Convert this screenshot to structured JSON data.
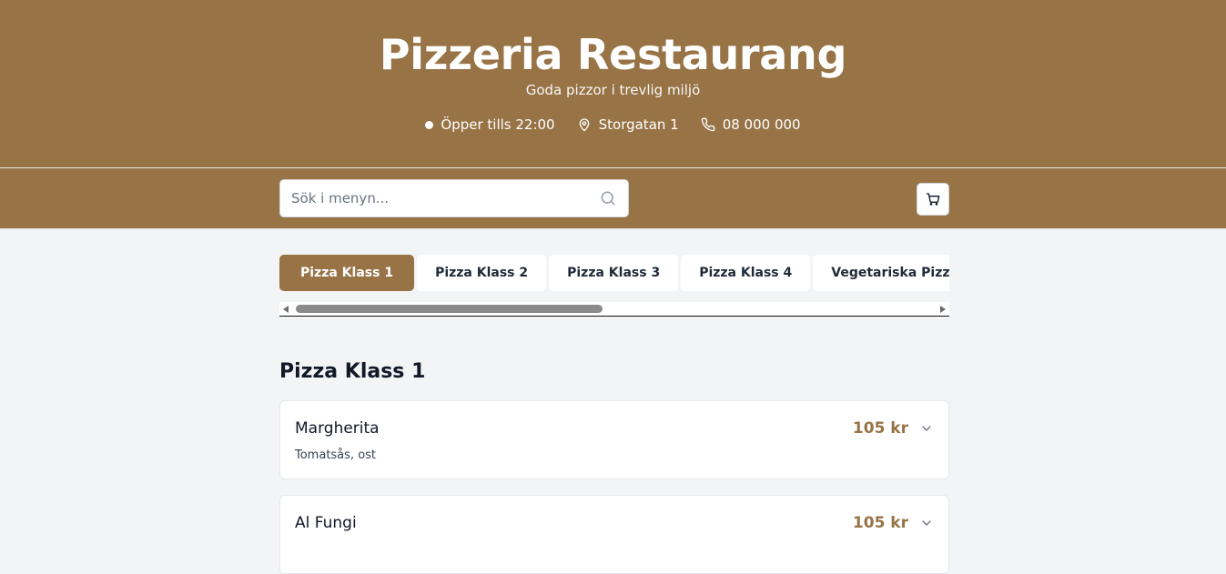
{
  "header": {
    "title": "Pizzeria Restaurang",
    "tagline": "Goda pizzor i trevlig miljö",
    "hours": "Öpper tills 22:00",
    "address": "Storgatan 1",
    "phone": "08 000 000"
  },
  "search": {
    "placeholder": "Sök i menyn...",
    "value": ""
  },
  "tabs": [
    {
      "label": "Pizza Klass 1",
      "active": true
    },
    {
      "label": "Pizza Klass 2",
      "active": false
    },
    {
      "label": "Pizza Klass 3",
      "active": false
    },
    {
      "label": "Pizza Klass 4",
      "active": false
    },
    {
      "label": "Vegetariska Pizzor",
      "active": false
    }
  ],
  "section": {
    "title": "Pizza Klass 1"
  },
  "items": [
    {
      "name": "Margherita",
      "description": "Tomatsås, ost",
      "price": "105 kr"
    },
    {
      "name": "Al Fungi",
      "description": "",
      "price": "105 kr"
    }
  ],
  "colors": {
    "brand": "#977346",
    "background": "#f3f4f6"
  }
}
